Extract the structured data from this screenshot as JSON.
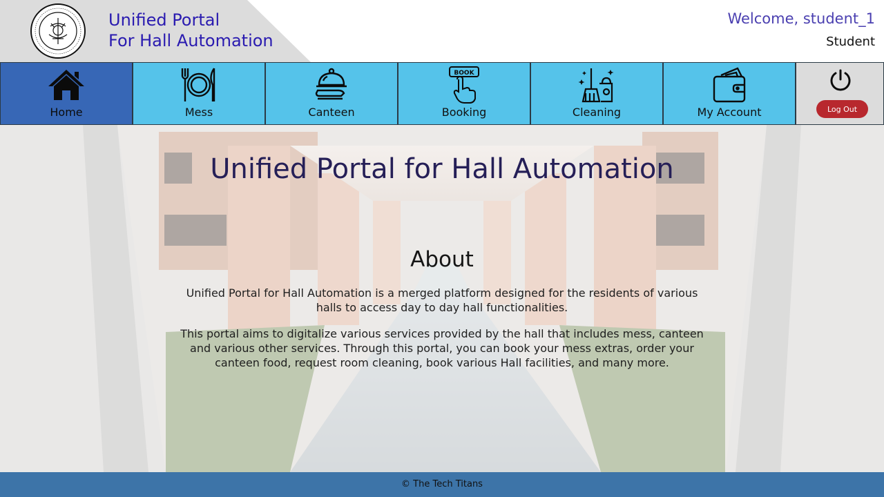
{
  "header": {
    "brand_line1": "Unified Portal",
    "brand_line2": "For Hall Automation",
    "welcome": "Welcome, student_1",
    "role": "Student"
  },
  "nav": {
    "items": [
      {
        "label": "Home",
        "icon": "home-icon",
        "active": true
      },
      {
        "label": "Mess",
        "icon": "plate-cutlery-icon"
      },
      {
        "label": "Canteen",
        "icon": "cloche-icon"
      },
      {
        "label": "Booking",
        "icon": "book-tap-icon"
      },
      {
        "label": "Cleaning",
        "icon": "cleaning-supplies-icon"
      },
      {
        "label": "My Account",
        "icon": "wallet-icon"
      }
    ],
    "logout_label": "Log Out"
  },
  "main": {
    "title": "Unified Portal for Hall Automation",
    "about_heading": "About",
    "about_p1": "Unified Portal for Hall Automation is a merged platform designed for the residents of various halls to access day to day hall functionalities.",
    "about_p2": "This portal aims to digitalize various services provided by the hall that includes mess, canteen and various other services. Through this portal, you can book your mess extras, order your canteen food, request room cleaning, book various Hall facilities, and many more."
  },
  "footer": {
    "text": "© The Tech Titans"
  },
  "colors": {
    "nav_bg": "#55c3ea",
    "nav_active": "#3767b6",
    "brand_text": "#2a1bb0",
    "logout": "#b8282e",
    "footer": "#3d74a8"
  }
}
